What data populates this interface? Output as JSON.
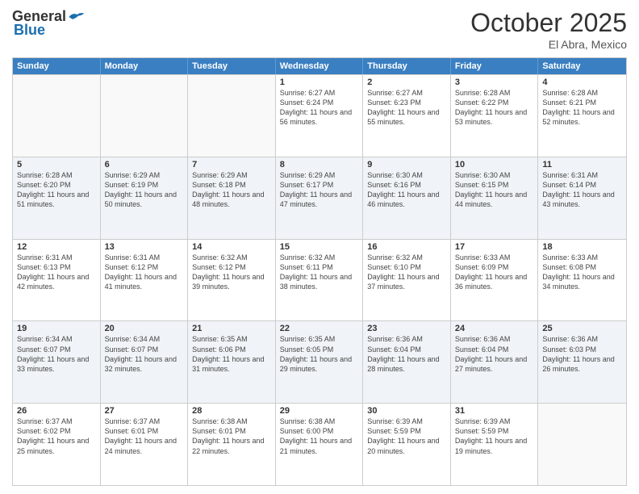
{
  "header": {
    "logo_general": "General",
    "logo_blue": "Blue",
    "month": "October 2025",
    "location": "El Abra, Mexico"
  },
  "days_of_week": [
    "Sunday",
    "Monday",
    "Tuesday",
    "Wednesday",
    "Thursday",
    "Friday",
    "Saturday"
  ],
  "weeks": [
    [
      {
        "day": "",
        "info": ""
      },
      {
        "day": "",
        "info": ""
      },
      {
        "day": "",
        "info": ""
      },
      {
        "day": "1",
        "info": "Sunrise: 6:27 AM\nSunset: 6:24 PM\nDaylight: 11 hours and 56 minutes."
      },
      {
        "day": "2",
        "info": "Sunrise: 6:27 AM\nSunset: 6:23 PM\nDaylight: 11 hours and 55 minutes."
      },
      {
        "day": "3",
        "info": "Sunrise: 6:28 AM\nSunset: 6:22 PM\nDaylight: 11 hours and 53 minutes."
      },
      {
        "day": "4",
        "info": "Sunrise: 6:28 AM\nSunset: 6:21 PM\nDaylight: 11 hours and 52 minutes."
      }
    ],
    [
      {
        "day": "5",
        "info": "Sunrise: 6:28 AM\nSunset: 6:20 PM\nDaylight: 11 hours and 51 minutes."
      },
      {
        "day": "6",
        "info": "Sunrise: 6:29 AM\nSunset: 6:19 PM\nDaylight: 11 hours and 50 minutes."
      },
      {
        "day": "7",
        "info": "Sunrise: 6:29 AM\nSunset: 6:18 PM\nDaylight: 11 hours and 48 minutes."
      },
      {
        "day": "8",
        "info": "Sunrise: 6:29 AM\nSunset: 6:17 PM\nDaylight: 11 hours and 47 minutes."
      },
      {
        "day": "9",
        "info": "Sunrise: 6:30 AM\nSunset: 6:16 PM\nDaylight: 11 hours and 46 minutes."
      },
      {
        "day": "10",
        "info": "Sunrise: 6:30 AM\nSunset: 6:15 PM\nDaylight: 11 hours and 44 minutes."
      },
      {
        "day": "11",
        "info": "Sunrise: 6:31 AM\nSunset: 6:14 PM\nDaylight: 11 hours and 43 minutes."
      }
    ],
    [
      {
        "day": "12",
        "info": "Sunrise: 6:31 AM\nSunset: 6:13 PM\nDaylight: 11 hours and 42 minutes."
      },
      {
        "day": "13",
        "info": "Sunrise: 6:31 AM\nSunset: 6:12 PM\nDaylight: 11 hours and 41 minutes."
      },
      {
        "day": "14",
        "info": "Sunrise: 6:32 AM\nSunset: 6:12 PM\nDaylight: 11 hours and 39 minutes."
      },
      {
        "day": "15",
        "info": "Sunrise: 6:32 AM\nSunset: 6:11 PM\nDaylight: 11 hours and 38 minutes."
      },
      {
        "day": "16",
        "info": "Sunrise: 6:32 AM\nSunset: 6:10 PM\nDaylight: 11 hours and 37 minutes."
      },
      {
        "day": "17",
        "info": "Sunrise: 6:33 AM\nSunset: 6:09 PM\nDaylight: 11 hours and 36 minutes."
      },
      {
        "day": "18",
        "info": "Sunrise: 6:33 AM\nSunset: 6:08 PM\nDaylight: 11 hours and 34 minutes."
      }
    ],
    [
      {
        "day": "19",
        "info": "Sunrise: 6:34 AM\nSunset: 6:07 PM\nDaylight: 11 hours and 33 minutes."
      },
      {
        "day": "20",
        "info": "Sunrise: 6:34 AM\nSunset: 6:07 PM\nDaylight: 11 hours and 32 minutes."
      },
      {
        "day": "21",
        "info": "Sunrise: 6:35 AM\nSunset: 6:06 PM\nDaylight: 11 hours and 31 minutes."
      },
      {
        "day": "22",
        "info": "Sunrise: 6:35 AM\nSunset: 6:05 PM\nDaylight: 11 hours and 29 minutes."
      },
      {
        "day": "23",
        "info": "Sunrise: 6:36 AM\nSunset: 6:04 PM\nDaylight: 11 hours and 28 minutes."
      },
      {
        "day": "24",
        "info": "Sunrise: 6:36 AM\nSunset: 6:04 PM\nDaylight: 11 hours and 27 minutes."
      },
      {
        "day": "25",
        "info": "Sunrise: 6:36 AM\nSunset: 6:03 PM\nDaylight: 11 hours and 26 minutes."
      }
    ],
    [
      {
        "day": "26",
        "info": "Sunrise: 6:37 AM\nSunset: 6:02 PM\nDaylight: 11 hours and 25 minutes."
      },
      {
        "day": "27",
        "info": "Sunrise: 6:37 AM\nSunset: 6:01 PM\nDaylight: 11 hours and 24 minutes."
      },
      {
        "day": "28",
        "info": "Sunrise: 6:38 AM\nSunset: 6:01 PM\nDaylight: 11 hours and 22 minutes."
      },
      {
        "day": "29",
        "info": "Sunrise: 6:38 AM\nSunset: 6:00 PM\nDaylight: 11 hours and 21 minutes."
      },
      {
        "day": "30",
        "info": "Sunrise: 6:39 AM\nSunset: 5:59 PM\nDaylight: 11 hours and 20 minutes."
      },
      {
        "day": "31",
        "info": "Sunrise: 6:39 AM\nSunset: 5:59 PM\nDaylight: 11 hours and 19 minutes."
      },
      {
        "day": "",
        "info": ""
      }
    ]
  ]
}
